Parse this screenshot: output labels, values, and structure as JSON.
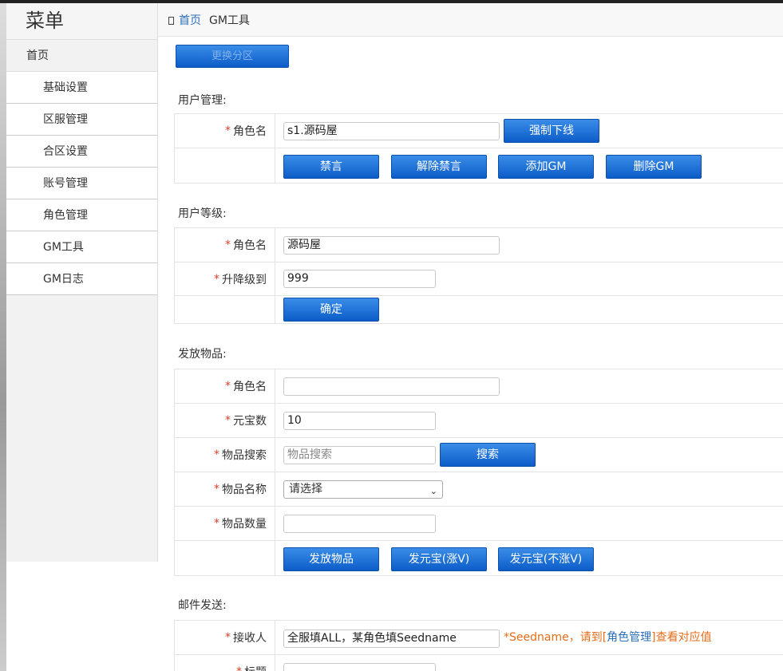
{
  "sidebar": {
    "title": "菜单",
    "home": "首页",
    "items": [
      "基础设置",
      "区服管理",
      "合区设置",
      "账号管理",
      "角色管理",
      "GM工具",
      "GM日志"
    ]
  },
  "header": {
    "home_link": "首页",
    "current": "GM工具"
  },
  "switch_button": "更换分区",
  "user_manage": {
    "title": "用户管理:",
    "role_label": "角色名",
    "role_value": "s1.源码屋",
    "kick_button": "强制下线",
    "ban_button": "禁言",
    "unban_button": "解除禁言",
    "add_gm_button": "添加GM",
    "del_gm_button": "删除GM"
  },
  "user_level": {
    "title": "用户等级:",
    "role_label": "角色名",
    "role_value": "源码屋",
    "level_label": "升降级到",
    "level_value": "999",
    "confirm_button": "确定"
  },
  "items_send": {
    "title": "发放物品:",
    "role_label": "角色名",
    "role_value": "",
    "gold_label": "元宝数",
    "gold_value": "10",
    "search_label": "物品搜索",
    "search_placeholder": "物品搜索",
    "search_button": "搜索",
    "name_label": "物品名称",
    "name_selected": "请选择",
    "qty_label": "物品数量",
    "qty_value": "",
    "send_button": "发放物品",
    "gold_v_button": "发元宝(涨V)",
    "gold_nov_button": "发元宝(不涨V)"
  },
  "mail": {
    "title": "邮件发送:",
    "receiver_label": "接收人",
    "receiver_value": "全服填ALL，某角色填Seedname",
    "hint_pre": "*Seedname，请到[",
    "hint_link": "角色管理",
    "hint_post": "]查看对应值",
    "subject_label": "标题"
  },
  "colors": {
    "accent": "#0c5cc8",
    "star": "#e0402a",
    "hint": "#e56d1a",
    "link": "#2a6fb8"
  }
}
